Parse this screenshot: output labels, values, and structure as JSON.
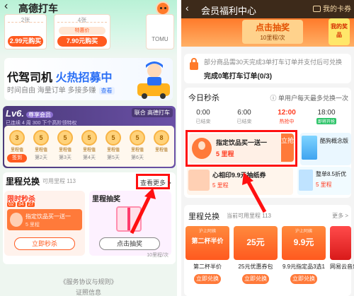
{
  "left": {
    "header": {
      "back_icon": "back-arrow-icon",
      "title": "高德打车",
      "mascot_icon": "mascot-icon"
    },
    "tickets": [
      {
        "label": "2张",
        "badge": "",
        "price": "2.99元购买",
        "brand": ""
      },
      {
        "label": "4张",
        "badge": "特惠价",
        "price": "7.90元购买",
        "brand": ""
      },
      {
        "label": "",
        "badge": "",
        "price": "",
        "brand": "TOMU"
      }
    ],
    "driver_banner": {
      "title_prefix": "代驾司机",
      "title_highlight": "火热招募中",
      "subtitle": "时间自由 海量订单 多接多赚",
      "look_label": "查看"
    },
    "level_card": {
      "title": "Lv6.",
      "title_tag": "尊享会员",
      "subtitle": "已连续 4 周 300 下个高阶领特权",
      "cobrand": "联合 高德打车",
      "days": [
        {
          "coin": "3",
          "coin_label": "里程值",
          "label": "签到"
        },
        {
          "coin": "5",
          "coin_label": "里程值",
          "label": "第2天"
        },
        {
          "coin": "5",
          "coin_label": "里程值",
          "label": "第3天"
        },
        {
          "coin": "5",
          "coin_label": "里程值",
          "label": "第4天"
        },
        {
          "coin": "5",
          "coin_label": "里程值",
          "label": "第5天"
        },
        {
          "coin": "5",
          "coin_label": "里程值",
          "label": "第6天"
        },
        {
          "coin": "8",
          "coin_label": "里程值",
          "label": ""
        }
      ]
    },
    "redeem": {
      "title": "里程兑换",
      "subtitle": "可用里程 113",
      "more_label": "查看更多 >",
      "flash": {
        "title": "限时秒杀",
        "timer": [
          "02",
          "34",
          "27"
        ],
        "item_name": "指定饮品买一送一",
        "item_points": "5 里程",
        "button": "立即秒杀"
      },
      "lottery": {
        "title": "里程抽奖",
        "button": "点击抽奖",
        "cost": "10里程/次"
      }
    },
    "footer": {
      "terms": "《服务协议与规则》",
      "license": "证照信息"
    }
  },
  "right": {
    "header": {
      "back_icon": "back-arrow-icon",
      "title": "会员福利中心",
      "card_label": "我的卡券"
    },
    "banner": {
      "button_text": "点击抽奖",
      "button_sub": "10里程/次",
      "prize_text": "我的奖品"
    },
    "notice": {
      "line1": "部分商品需30天完成3单打车订单并支付后可兑换",
      "line2": "完成0笔打车订单(0/3)"
    },
    "today": {
      "title": "今日秒杀",
      "limit_note": "ⓘ 单用户每天最多兑换一次",
      "slots": [
        {
          "time": "0:00",
          "status": "已结束",
          "tag": ""
        },
        {
          "time": "6:00",
          "status": "已结束",
          "tag": ""
        },
        {
          "time": "12:00",
          "status": "热抢中",
          "tag": ""
        },
        {
          "time": "18:00",
          "status": "即将开始",
          "tag": "即将开抢"
        }
      ],
      "main_deal": {
        "name": "指定饮品买一送一",
        "points": "5 里程",
        "button": "立抢"
      },
      "side_deal": {
        "name": "酷狗概念版"
      },
      "deal_b": {
        "name": "心相印9.9元抽纸券",
        "points": "5 里程"
      },
      "deal_c": {
        "name": "整单8.5折优",
        "points": "5 里程"
      }
    },
    "redeem": {
      "title": "里程兑换",
      "subtitle": "当前可用里程 113",
      "more_label": "更多 >",
      "coupons": [
        {
          "top": "沪上阿姨",
          "big": "第二杯半价",
          "name": "第二杯半价",
          "button": "立即兑换"
        },
        {
          "top": "",
          "big": "25元",
          "name": "25元优惠券包",
          "button": "立即兑换"
        },
        {
          "top": "沪上阿姨",
          "big": "9.9元",
          "name": "9.9元指定品3选1",
          "button": "立即兑换"
        },
        {
          "top": "",
          "big": "",
          "name": "网易云音乐",
          "button": "立即兑换"
        }
      ]
    }
  },
  "colors": {
    "accent": "#ff5a1f",
    "highlight_box": "#ff1010",
    "left_bg": "#eef6f0",
    "right_header": "#3d2a1a"
  }
}
